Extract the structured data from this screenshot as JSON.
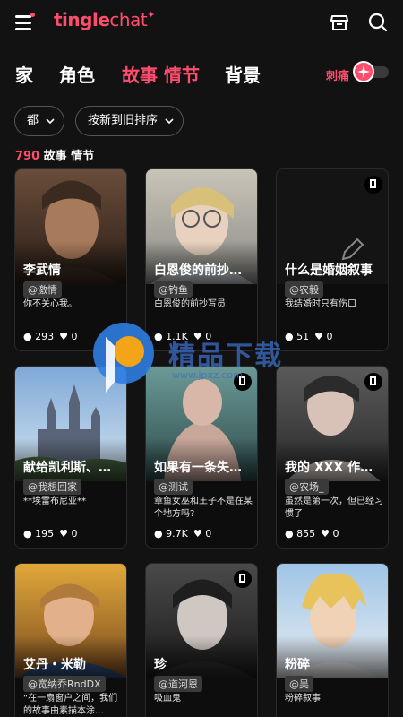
{
  "app": {
    "logo_bold": "tingle",
    "logo_light": "chat",
    "logo_spark": "✦"
  },
  "tabs": [
    {
      "label": "家",
      "active": false
    },
    {
      "label": "角色",
      "active": false
    },
    {
      "label": "故事 情节",
      "active": true
    },
    {
      "label": "背景",
      "active": false
    }
  ],
  "toggle": {
    "label": "刺痛",
    "on": false
  },
  "filters": {
    "category": "都",
    "sort": "按新到旧排序"
  },
  "summary": {
    "count": "790",
    "label": "故事 情节"
  },
  "cards": [
    {
      "title": "李武情",
      "author": "@激情",
      "desc": "你不关心我。",
      "views": "293",
      "likes": "0",
      "bookmark": false
    },
    {
      "title": "白恩俊的前抄…",
      "author": "@钓鱼",
      "desc": "白恩俊的前抄写员",
      "views": "1.1K",
      "likes": "0",
      "bookmark": false
    },
    {
      "title": "什么是婚姻叙事",
      "author": "@农毅",
      "desc": "我结婚时只有伤口",
      "views": "51",
      "likes": "0",
      "bookmark": true
    },
    {
      "title": "献给凯利斯、…",
      "author": "@我想回家",
      "desc": "**埃雷布尼亚**",
      "views": "195",
      "likes": "0",
      "bookmark": false
    },
    {
      "title": "如果有一条失…",
      "author": "@测试",
      "desc": "章鱼女巫和王子不是在某个地方吗?",
      "views": "9.7K",
      "likes": "0",
      "bookmark": true
    },
    {
      "title": "我的 XXX 作…",
      "author": "@农场_",
      "desc": "虽然是第一次，但已经习惯了",
      "views": "855",
      "likes": "0",
      "bookmark": true
    },
    {
      "title": "艾丹・米勒",
      "author": "@宽纳乔RndDX",
      "desc": "“在一扇窗户之间，我们的故事由素描本涂…",
      "views": "",
      "likes": "",
      "bookmark": false
    },
    {
      "title": "珍",
      "author": "@道河恩",
      "desc": "吸血鬼",
      "views": "",
      "likes": "",
      "bookmark": true
    },
    {
      "title": "粉碎",
      "author": "@吴",
      "desc": "粉碎叙事",
      "views": "",
      "likes": "",
      "bookmark": false
    }
  ],
  "watermark": {
    "text": "精品下载",
    "url": "www.jpxz.com"
  },
  "colors": {
    "accent": "#ff4d6d",
    "background": "#121212"
  }
}
